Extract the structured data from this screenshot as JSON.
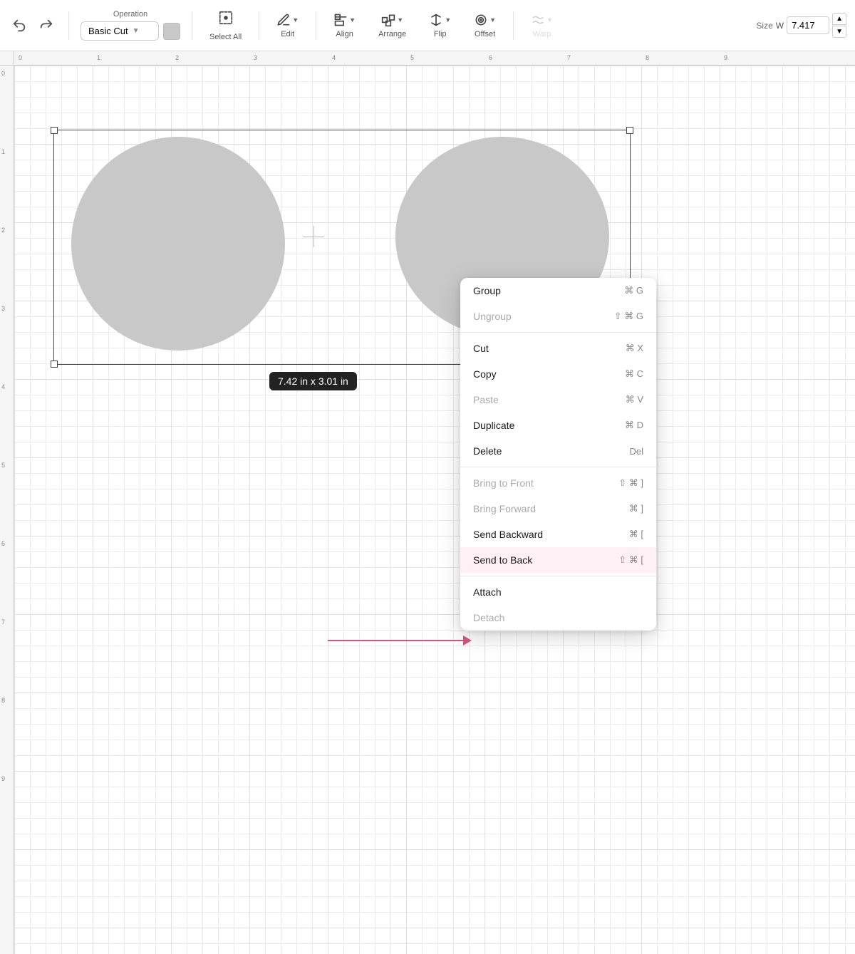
{
  "toolbar": {
    "undo_label": "↩",
    "redo_label": "↪",
    "operation_label": "Operation",
    "operation_value": "Basic Cut",
    "select_all_label": "Select All",
    "edit_label": "Edit",
    "align_label": "Align",
    "arrange_label": "Arrange",
    "flip_label": "Flip",
    "offset_label": "Offset",
    "warp_label": "Warp",
    "size_label": "Size",
    "size_w": "W",
    "size_value": "7.417"
  },
  "canvas": {
    "dimension_text": "7.42  in x 3.01  in",
    "ruler_numbers_h": [
      "0",
      "1",
      "2",
      "3",
      "4",
      "5",
      "6",
      "7",
      "8",
      "9"
    ],
    "ruler_numbers_v": [
      "0",
      "1",
      "2",
      "3",
      "4",
      "5",
      "6",
      "7",
      "8",
      "9"
    ]
  },
  "context_menu": {
    "items": [
      {
        "label": "Group",
        "shortcut": "⌘ G",
        "disabled": false,
        "highlighted": false
      },
      {
        "label": "Ungroup",
        "shortcut": "⇧ ⌘ G",
        "disabled": true,
        "highlighted": false
      },
      {
        "separator_before": true
      },
      {
        "label": "Cut",
        "shortcut": "⌘ X",
        "disabled": false,
        "highlighted": false
      },
      {
        "label": "Copy",
        "shortcut": "⌘ C",
        "disabled": false,
        "highlighted": false
      },
      {
        "label": "Paste",
        "shortcut": "⌘ V",
        "disabled": true,
        "highlighted": false
      },
      {
        "label": "Duplicate",
        "shortcut": "⌘ D",
        "disabled": false,
        "highlighted": false
      },
      {
        "label": "Delete",
        "shortcut": "Del",
        "disabled": false,
        "highlighted": false
      },
      {
        "separator_before": true
      },
      {
        "label": "Bring to Front",
        "shortcut": "⇧ ⌘ ]",
        "disabled": true,
        "highlighted": false
      },
      {
        "label": "Bring Forward",
        "shortcut": "⌘ ]",
        "disabled": true,
        "highlighted": false
      },
      {
        "label": "Send Backward",
        "shortcut": "⌘ [",
        "disabled": false,
        "highlighted": false
      },
      {
        "label": "Send to Back",
        "shortcut": "⇧ ⌘ [",
        "disabled": false,
        "highlighted": true
      },
      {
        "separator_before": true
      },
      {
        "label": "Attach",
        "shortcut": "",
        "disabled": false,
        "highlighted": false
      },
      {
        "label": "Detach",
        "shortcut": "",
        "disabled": true,
        "highlighted": false
      }
    ]
  }
}
